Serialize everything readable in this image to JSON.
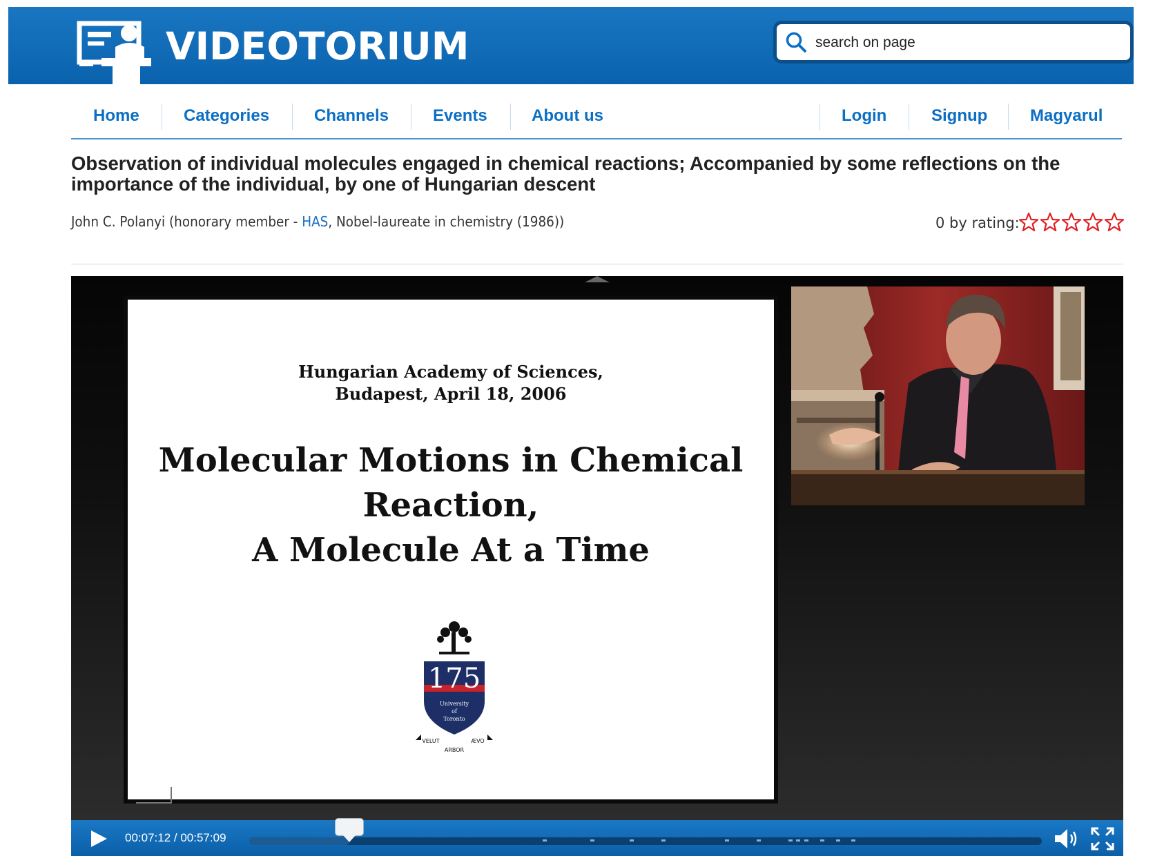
{
  "brand": {
    "name": "VIDEOTORIUM",
    "logo_icon": "lecturer-podium-icon"
  },
  "search": {
    "placeholder": "search on page",
    "icon": "search-icon"
  },
  "nav": {
    "left": [
      "Home",
      "Categories",
      "Channels",
      "Events",
      "About us"
    ],
    "right": [
      "Login",
      "Signup",
      "Magyarul"
    ]
  },
  "video": {
    "title": "Observation of individual molecules engaged in chemical reactions; Accompanied by some reflections on the importance of the individual, by one of Hungarian descent",
    "presenter": {
      "name_prefix": "John C. Polanyi (honorary member - ",
      "org_link": "HAS",
      "name_suffix": ", Nobel-laureate in chemistry (1986))"
    },
    "rating": {
      "label": "0 by rating:",
      "value": 0,
      "max": 5,
      "star_color": "#e01f26"
    }
  },
  "slide": {
    "header_line1": "Hungarian Academy of Sciences,",
    "header_line2": "Budapest, April 18, 2006",
    "title_line1": "Molecular Motions in Chemical",
    "title_line2": "Reaction,",
    "title_line3": "A Molecule At a Time",
    "crest": {
      "number": "175",
      "text_line1": "University",
      "text_line2": "of",
      "text_line3": "Toronto",
      "motto_left": "VELUT",
      "motto_right": "ÆVO",
      "motto_bottom": "ARBOR"
    }
  },
  "player": {
    "time_display": "00:07:12 / 00:57:09",
    "current_seconds": 432,
    "duration_seconds": 3429,
    "chapter_markers": [
      0.37,
      0.43,
      0.48,
      0.52,
      0.6,
      0.64,
      0.68,
      0.69,
      0.7,
      0.72,
      0.74,
      0.76
    ],
    "icons": [
      "play-icon",
      "volume-icon",
      "fullscreen-icon"
    ],
    "accent_color": "#0b6fc4"
  }
}
